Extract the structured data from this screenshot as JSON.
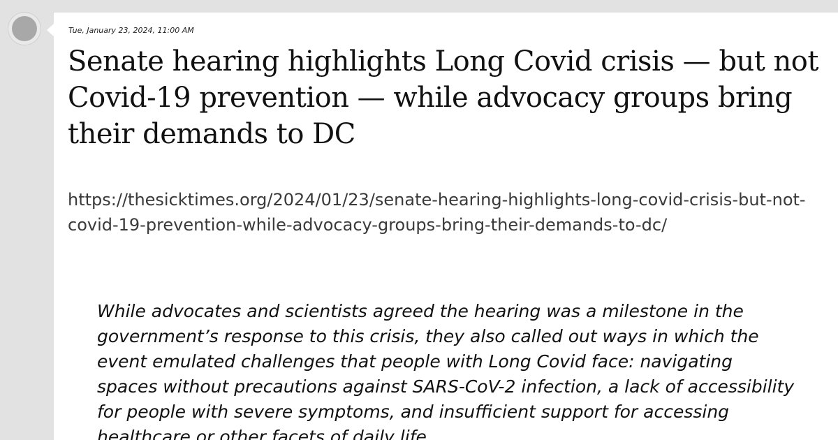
{
  "post": {
    "timestamp": "Tue, January 23, 2024, 11:00 AM",
    "title": "Senate hearing highlights Long Covid crisis — but not Covid-19 prevention — while advocacy groups bring their demands to DC",
    "url": "https://thesicktimes.org/2024/01/23/senate-hearing-highlights-long-covid-crisis-but-not-covid-19-prevention-while-advocacy-groups-bring-their-demands-to-dc/",
    "quote": "While advocates and scientists agreed the hearing was a milestone in the government’s response to this crisis, they also called out ways in which the event emulated challenges that people with Long Covid face: navigating spaces without precautions against SARS-CoV-2 infection, a lack of accessibility for people with severe symptoms, and insufficient support for accessing healthcare or other facets of daily life."
  },
  "colors": {
    "background": "#e2e2e2",
    "card": "#ffffff",
    "avatar": "#a8a8a8",
    "url_text": "#3a3a3a"
  }
}
